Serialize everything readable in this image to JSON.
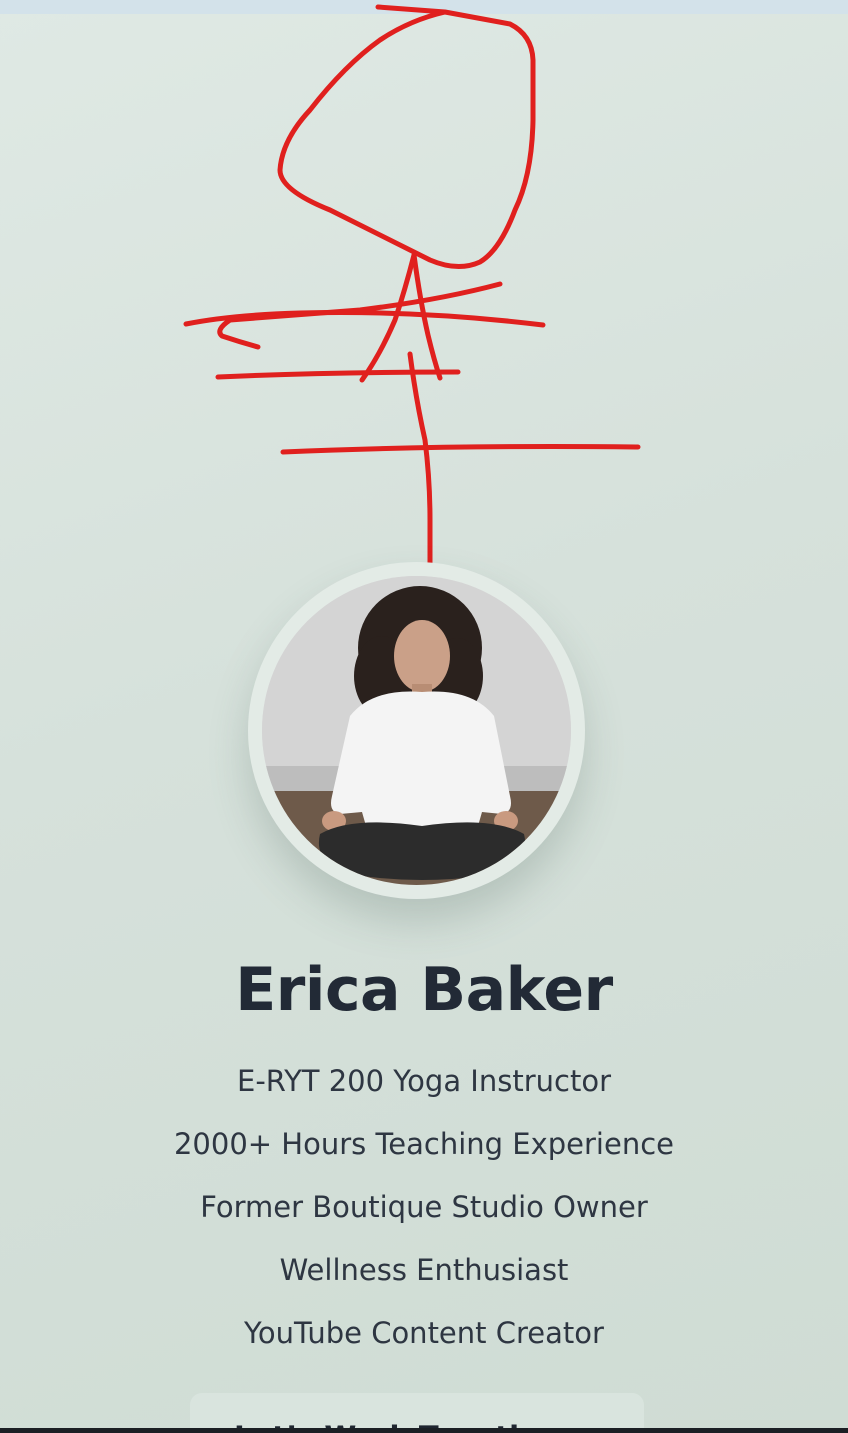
{
  "profile": {
    "name": "Erica Baker",
    "photo": "profile-photo"
  },
  "credentials": [
    "E-RYT 200 Yoga Instructor",
    "2000+ Hours Teaching Experience",
    "Former Boutique Studio Owner",
    "Wellness Enthusiast",
    "YouTube Content Creator"
  ],
  "cta": {
    "label": "Let’s Work Together",
    "arrow": "→"
  },
  "annotation": {
    "color": "#e0201e"
  },
  "colors": {
    "background": "#d6e1db",
    "text": "#222a36",
    "button": "#d9e4de"
  }
}
